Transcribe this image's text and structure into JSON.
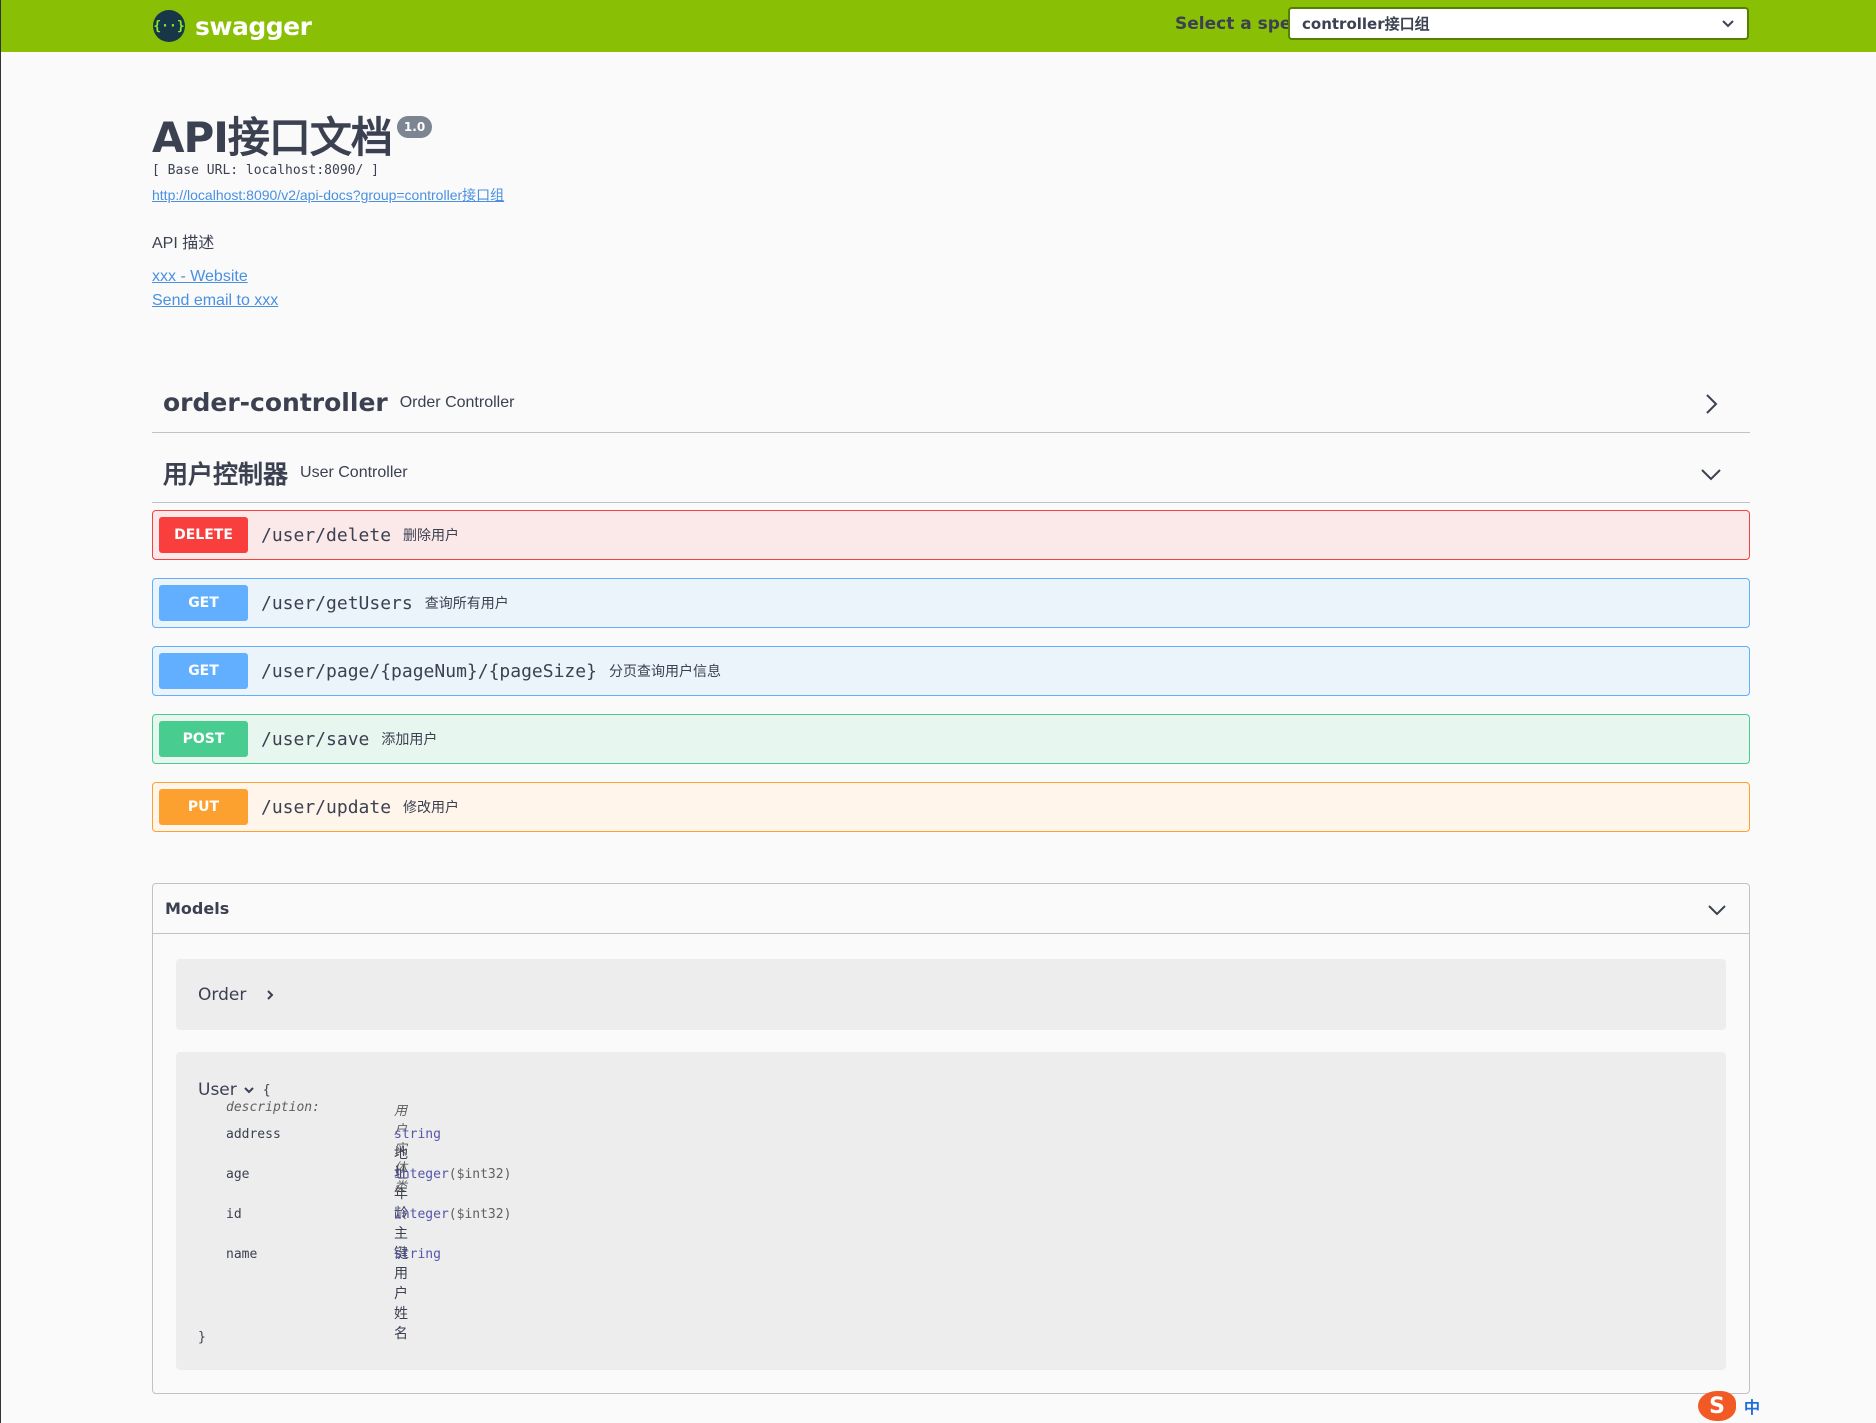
{
  "topbar": {
    "logo_glyph": "{··}",
    "logo_text": "swagger",
    "spec_label": "Select a spec",
    "spec_value": "controller接口组"
  },
  "info": {
    "title": "API接口文档",
    "version": "1.0",
    "base_url": "[ Base URL: localhost:8090/ ]",
    "api_docs_link": "http://localhost:8090/v2/api-docs?group=controller接口组",
    "description": "API 描述",
    "website_link": "xxx - Website",
    "email_link": "Send email to xxx"
  },
  "tags": [
    {
      "name": "order-controller",
      "description": "Order Controller",
      "expanded": false
    },
    {
      "name": "用户控制器",
      "description": "User Controller",
      "expanded": true
    }
  ],
  "operations": [
    {
      "method": "DELETE",
      "path": "/user/delete",
      "summary": "删除用户"
    },
    {
      "method": "GET",
      "path": "/user/getUsers",
      "summary": "查询所有用户"
    },
    {
      "method": "GET",
      "path": "/user/page/{pageNum}/{pageSize}",
      "summary": "分页查询用户信息"
    },
    {
      "method": "POST",
      "path": "/user/save",
      "summary": "添加用户"
    },
    {
      "method": "PUT",
      "path": "/user/update",
      "summary": "修改用户"
    }
  ],
  "models": {
    "label": "Models",
    "order": {
      "name": "Order"
    },
    "user": {
      "name": "User",
      "open_brace": "{",
      "close_brace": "}",
      "description_key": "description:",
      "description_value": "用户实体类",
      "properties": [
        {
          "name": "address",
          "type": "string",
          "format": "",
          "desc": "地址"
        },
        {
          "name": "age",
          "type": "integer",
          "format": "($int32)",
          "desc": "年龄"
        },
        {
          "name": "id",
          "type": "integer",
          "format": "($int32)",
          "desc": "主键"
        },
        {
          "name": "name",
          "type": "string",
          "format": "",
          "desc": "用户姓名"
        }
      ]
    }
  },
  "ime": {
    "logo": "S",
    "lang": "中"
  },
  "colors": {
    "topbar": "#89bf04",
    "delete": "#f93e3e",
    "get": "#61affe",
    "post": "#49cc90",
    "put": "#fca130"
  }
}
